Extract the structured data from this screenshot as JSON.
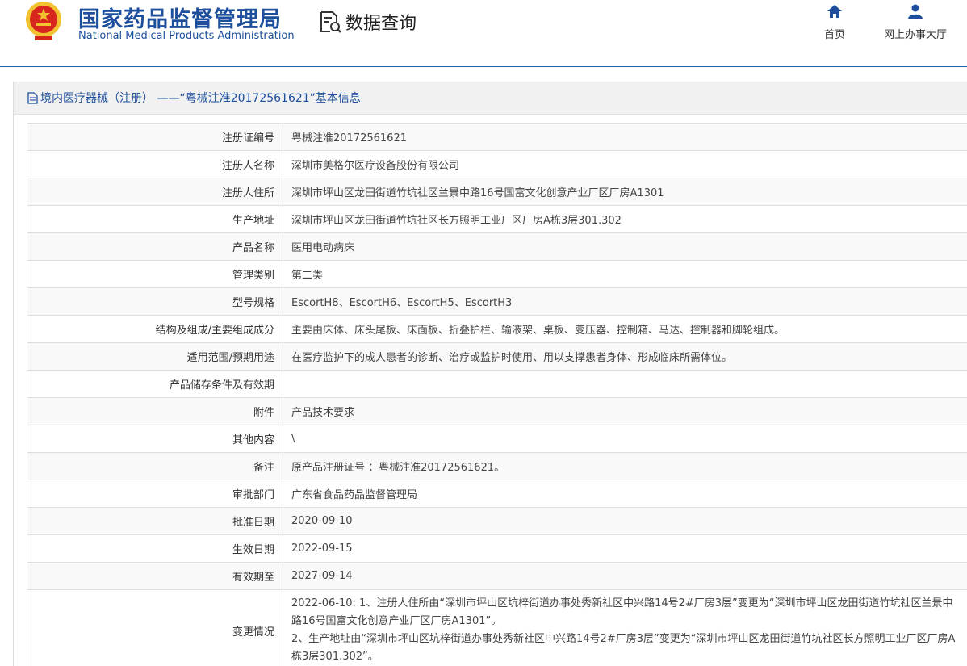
{
  "header": {
    "title_cn": "国家药品监督管理局",
    "title_en": "National Medical Products Administration",
    "query_label": "数据查询",
    "nav": [
      {
        "label": "首页",
        "icon": "home-icon"
      },
      {
        "label": "网上办事大厅",
        "icon": "user-icon"
      }
    ]
  },
  "panel": {
    "title": "境内医疗器械（注册） ——“粤械注准20172561621”基本信息",
    "rows": [
      {
        "key": "注册证编号",
        "value": "粤械注准20172561621"
      },
      {
        "key": "注册人名称",
        "value": "深圳市美格尔医疗设备股份有限公司"
      },
      {
        "key": "注册人住所",
        "value": "深圳市坪山区龙田街道竹坑社区兰景中路16号国富文化创意产业厂区厂房A1301"
      },
      {
        "key": "生产地址",
        "value": "深圳市坪山区龙田街道竹坑社区长方照明工业厂区厂房A栋3层301.302"
      },
      {
        "key": "产品名称",
        "value": "医用电动病床"
      },
      {
        "key": "管理类别",
        "value": "第二类"
      },
      {
        "key": "型号规格",
        "value": "EscortH8、EscortH6、EscortH5、EscortH3"
      },
      {
        "key": "结构及组成/主要组成成分",
        "value": "主要由床体、床头尾板、床面板、折叠护栏、输液架、桌板、变压器、控制箱、马达、控制器和脚轮组成。"
      },
      {
        "key": "适用范围/预期用途",
        "value": "在医疗监护下的成人患者的诊断、治疗或监护时使用、用以支撑患者身体、形成临床所需体位。"
      },
      {
        "key": "产品储存条件及有效期",
        "value": ""
      },
      {
        "key": "附件",
        "value": "产品技术要求"
      },
      {
        "key": "其他内容",
        "value": "\\"
      },
      {
        "key": "备注",
        "value": "原产品注册证号 ：粤械注准20172561621。"
      },
      {
        "key": "审批部门",
        "value": "广东省食品药品监督管理局"
      },
      {
        "key": "批准日期",
        "value": "2020-09-10"
      },
      {
        "key": "生效日期",
        "value": "2022-09-15"
      },
      {
        "key": "有效期至",
        "value": "2027-09-14"
      }
    ],
    "change_row": {
      "key": "变更情况",
      "lines": [
        "2022-06-10: 1、注册人住所由“深圳市坪山区坑梓街道办事处秀新社区中兴路14号2#厂房3层”变更为“深圳市坪山区龙田街道竹坑社区兰景中路16号国富文化创意产业厂区厂房A1301”。",
        "2、生产地址由“深圳市坪山区坑梓街道办事处秀新社区中兴路14号2#厂房3层”变更为“深圳市坪山区龙田街道竹坑社区长方照明工业厂区厂房A栋3层301.302”。"
      ]
    }
  },
  "colors": {
    "brand_blue": "#1d4f9c",
    "emblem_red": "#d7261e",
    "emblem_gold": "#f2c230"
  }
}
